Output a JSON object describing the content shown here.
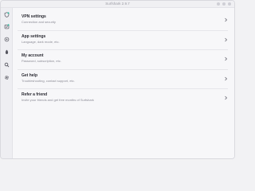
{
  "window": {
    "title": "Surfshark 2.9.7"
  },
  "sidebar": {
    "items": [
      {
        "name": "shield-icon"
      },
      {
        "name": "antivirus-icon"
      },
      {
        "name": "alert-icon"
      },
      {
        "name": "bug-icon"
      },
      {
        "name": "search-icon"
      },
      {
        "name": "settings-icon"
      }
    ]
  },
  "settings": {
    "items": [
      {
        "label": "VPN settings",
        "sub": "Connection and security"
      },
      {
        "label": "App settings",
        "sub": "Language, dark mode, etc."
      },
      {
        "label": "My account",
        "sub": "Password, subscription, etc."
      },
      {
        "label": "Get help",
        "sub": "Troubleshooting, contact support, etc."
      },
      {
        "label": "Refer a friend",
        "sub": "Invite your friends and get free months of Surfshark"
      }
    ]
  },
  "colors": {
    "background": "#f7f7f9",
    "text_primary": "#2b2b33",
    "text_secondary": "#8c8c96",
    "accent": "#1ebc9c"
  }
}
